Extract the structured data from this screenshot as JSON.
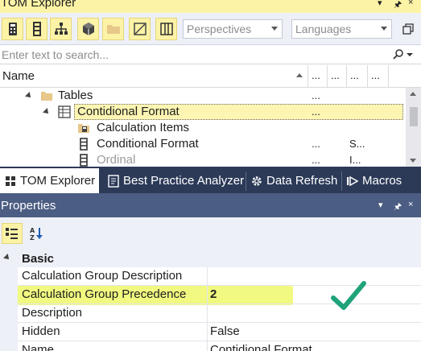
{
  "tom_explorer": {
    "title": "TOM Explorer",
    "pin_glyph": "▾",
    "close_glyph": "×"
  },
  "toolbar": {
    "icons": [
      "calculator-icon",
      "table-list-icon",
      "hierarchy-icon",
      "cube-icon",
      "folder-icon",
      "edit-pane-icon",
      "columns-icon"
    ],
    "perspectives_placeholder": "Perspectives",
    "languages_placeholder": "Languages",
    "end_icon": "copy-icon"
  },
  "search": {
    "placeholder": "Enter text to search..."
  },
  "tree_header": {
    "name": "Name",
    "col2": "...",
    "col3": "...",
    "col4": "...",
    "col5": "..."
  },
  "tree": {
    "rows": [
      {
        "label": "Tables",
        "col2": "...",
        "col4": ""
      },
      {
        "label": "Contidional Format",
        "col2": "...",
        "col4": ""
      },
      {
        "label": "Calculation Items",
        "col2": "",
        "col4": ""
      },
      {
        "label": "Conditional Format",
        "col2": "...",
        "col4": "S..."
      },
      {
        "label": "Ordinal",
        "col2": "...",
        "col4": "I..."
      }
    ]
  },
  "tabs": [
    {
      "label": "TOM Explorer",
      "icon": "tom-explorer-icon"
    },
    {
      "label": "Best Practice Analyzer",
      "icon": "bpa-icon"
    },
    {
      "label": "Data Refresh",
      "icon": "gear-icon"
    },
    {
      "label": "Macros",
      "icon": "macro-icon"
    }
  ],
  "properties": {
    "title": "Properties",
    "pin_glyph": "▾",
    "close_glyph": "×",
    "category": "Basic",
    "rows": [
      {
        "name": "Calculation Group Description",
        "value": ""
      },
      {
        "name": "Calculation Group Precedence",
        "value": "2"
      },
      {
        "name": "Description",
        "value": ""
      },
      {
        "name": "Hidden",
        "value": "False"
      },
      {
        "name": "Name",
        "value": "Contidional Format"
      }
    ]
  },
  "colors": {
    "accent_yellow": "#fdf3a6",
    "highlight": "#eef86a",
    "tabstrip": "#2c3a58",
    "properties_title": "#4b5d82",
    "checkmark": "#1ea37a"
  }
}
